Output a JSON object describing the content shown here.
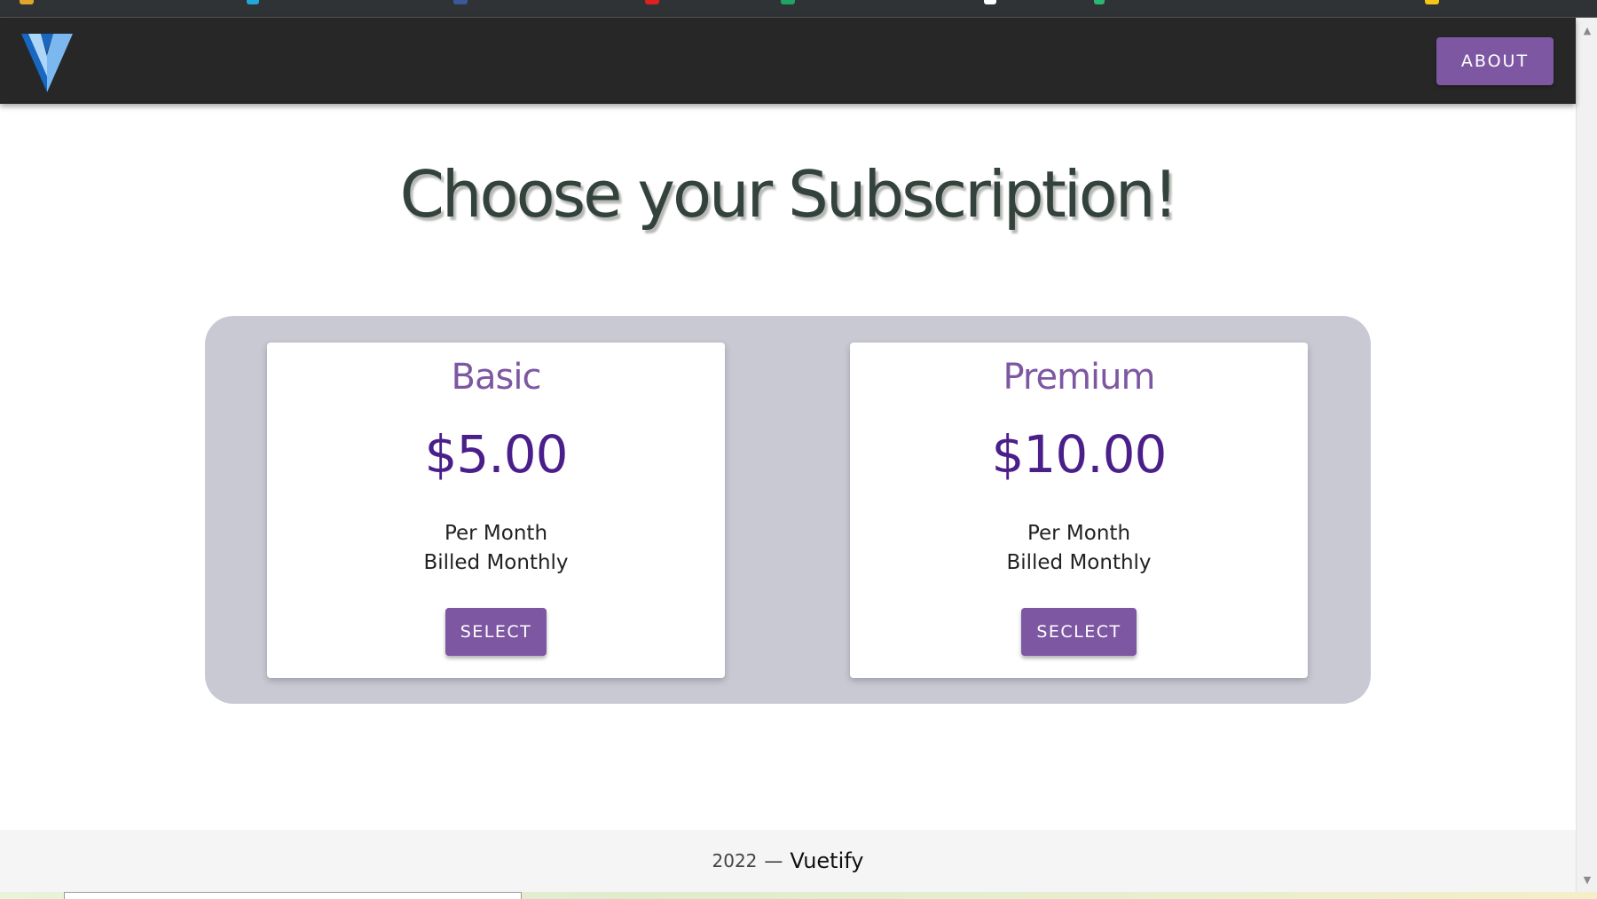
{
  "app_bar": {
    "logo_icon": "vuetify-logo-icon",
    "about_label": "ABOUT"
  },
  "main": {
    "title": "Choose your Subscription!"
  },
  "plans": [
    {
      "name": "Basic",
      "price": "$5.00",
      "period": "Per Month",
      "billing": "Billed Monthly",
      "button_label": "SELECT"
    },
    {
      "name": "Premium",
      "price": "$10.00",
      "period": "Per Month",
      "billing": "Billed Monthly",
      "button_label": "SECLECT"
    }
  ],
  "footer": {
    "year": "2022",
    "separator": "—",
    "brand": "Vuetify"
  },
  "scrollbar": {
    "up_icon": "scroll-up-arrow-icon",
    "down_icon": "scroll-down-arrow-icon"
  },
  "colors": {
    "app_bar": "#272727",
    "accent": "#7e57a3",
    "price": "#4b1f8a",
    "panel": "#c9c9d4",
    "title": "#33423c"
  }
}
